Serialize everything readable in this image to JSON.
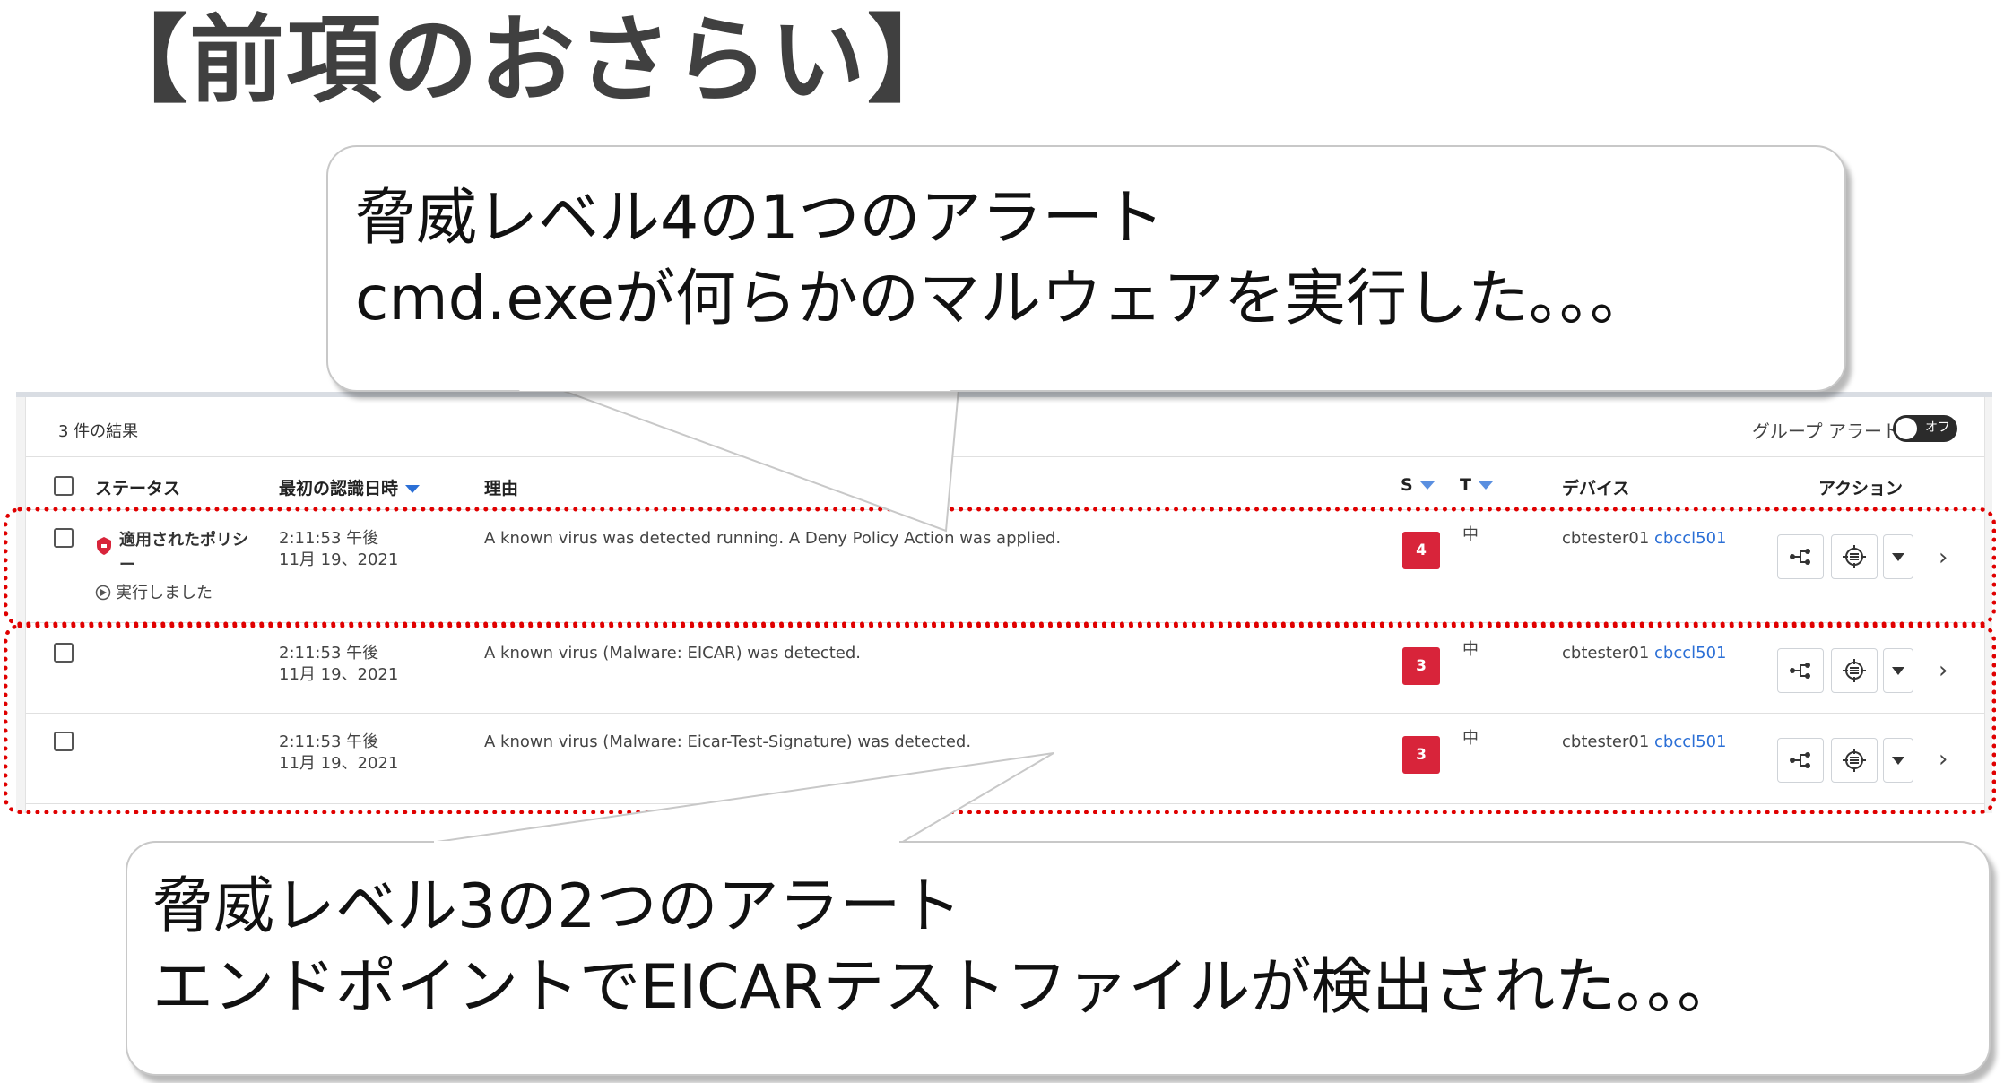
{
  "title": "【前項のおさらい】",
  "callout_top": {
    "line1": "脅威レベル4の1つのアラート",
    "line2": "cmd.exeが何らかのマルウェアを実行した。。。"
  },
  "callout_bottom": {
    "line1": "脅威レベル3の2つのアラート",
    "line2": "エンドポイントでEICARテストファイルが検出された。。。"
  },
  "panel": {
    "results": "3 件の結果",
    "group_alert_label": "グループ アラート",
    "group_toggle_state": "オフ",
    "columns": {
      "status": "ステータス",
      "first_seen": "最初の認識日時",
      "reason": "理由",
      "severity": "S",
      "type": "T",
      "device": "デバイス",
      "actions": "アクション"
    },
    "rows": [
      {
        "status": "適用されたポリシー",
        "status_sub": "実行しました",
        "time": "2:11:53 午後",
        "date": "11月 19、2021",
        "reason": "A known virus was detected running. A Deny Policy Action was applied.",
        "severity": "4",
        "type": "中",
        "device": "cbtester01",
        "device_link": "cbccl501"
      },
      {
        "status": "",
        "status_sub": "",
        "time": "2:11:53 午後",
        "date": "11月 19、2021",
        "reason": "A known virus (Malware: EICAR) was detected.",
        "severity": "3",
        "type": "中",
        "device": "cbtester01",
        "device_link": "cbccl501"
      },
      {
        "status": "",
        "status_sub": "",
        "time": "2:11:53 午後",
        "date": "11月 19、2021",
        "reason": "A known virus (Malware: Eicar-Test-Signature) was detected.",
        "severity": "3",
        "type": "中",
        "device": "cbtester01",
        "device_link": "cbccl501"
      }
    ]
  },
  "colors": {
    "severity_badge": "#d8243a",
    "highlight_dash": "#e00000",
    "link": "#2b6fd6"
  }
}
